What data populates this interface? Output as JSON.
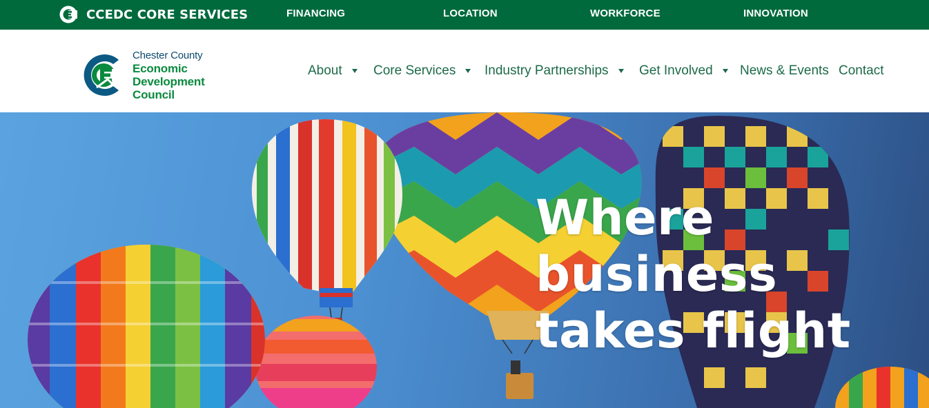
{
  "topbar": {
    "brand_label": "CCEDC CORE SERVICES",
    "brand_icon": "ccedc-monogram-icon",
    "links": [
      "FINANCING",
      "LOCATION",
      "WORKFORCE",
      "INNOVATION"
    ]
  },
  "logo": {
    "line1": "Chester County",
    "line2": "Economic",
    "line3": "Development",
    "line4": "Council",
    "icon": "ccedc-logo-mark"
  },
  "nav": {
    "items": [
      {
        "label": "About",
        "has_dropdown": true
      },
      {
        "label": "Core Services",
        "has_dropdown": true
      },
      {
        "label": "Industry Partnerships",
        "has_dropdown": true
      },
      {
        "label": "Get Involved",
        "has_dropdown": true
      },
      {
        "label": "News & Events",
        "has_dropdown": false
      },
      {
        "label": "Contact",
        "has_dropdown": false
      }
    ]
  },
  "hero": {
    "line1": "Where",
    "line2": "business",
    "line3": "takes flight",
    "image": "hot-air-balloons"
  },
  "colors": {
    "topbar_bg": "#006a3d",
    "nav_text": "#1c6a49",
    "logo_green": "#0a8a3f",
    "logo_blue": "#0c4a6e"
  }
}
